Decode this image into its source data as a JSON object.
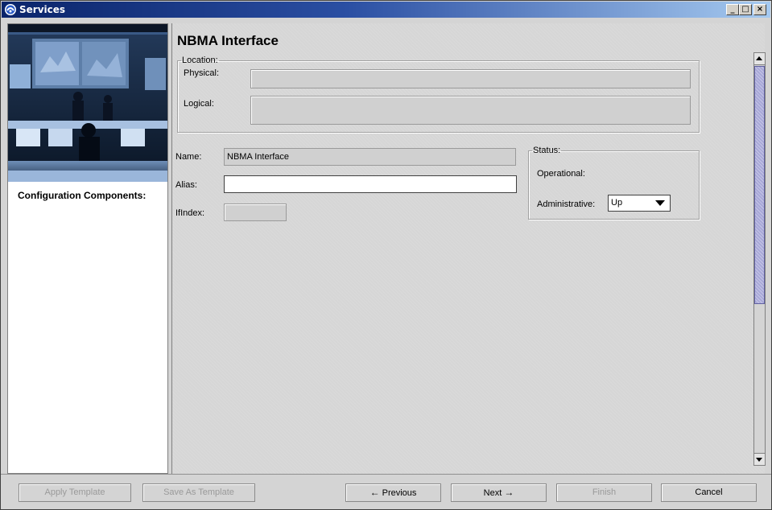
{
  "window": {
    "title": "Services",
    "controls": {
      "minimize": "_",
      "maximize": "□",
      "close": "×"
    }
  },
  "sidebar": {
    "heading": "Configuration Components:"
  },
  "main": {
    "title": "NBMA Interface",
    "location": {
      "legend": "Location:",
      "physical_label": "Physical:",
      "logical_label": "Logical:",
      "physical_value": "",
      "logical_value": ""
    },
    "name": {
      "label": "Name:",
      "value": "NBMA Interface"
    },
    "alias": {
      "label": "Alias:",
      "value": ""
    },
    "ifindex": {
      "label": "IfIndex:",
      "value": ""
    },
    "status": {
      "legend": "Status:",
      "operational_label": "Operational:",
      "operational_value": "",
      "administrative_label": "Administrative:",
      "administrative_value": "Up"
    }
  },
  "buttons": {
    "apply_template": "Apply Template",
    "save_as_template": "Save As Template",
    "previous": "Previous",
    "next": "Next",
    "finish": "Finish",
    "cancel": "Cancel",
    "prev_arrow": "←",
    "next_arrow": "→"
  },
  "icons": {
    "app": "services-app-icon",
    "scroll_up": "scroll-up-icon",
    "scroll_down": "scroll-down-icon",
    "dropdown": "chevron-down-icon"
  },
  "colors": {
    "titlebar_start": "#0a246a",
    "titlebar_end": "#a6caf0",
    "scroll_thumb": "#a8a8d8",
    "panel_bg": "#d6d6d6"
  }
}
